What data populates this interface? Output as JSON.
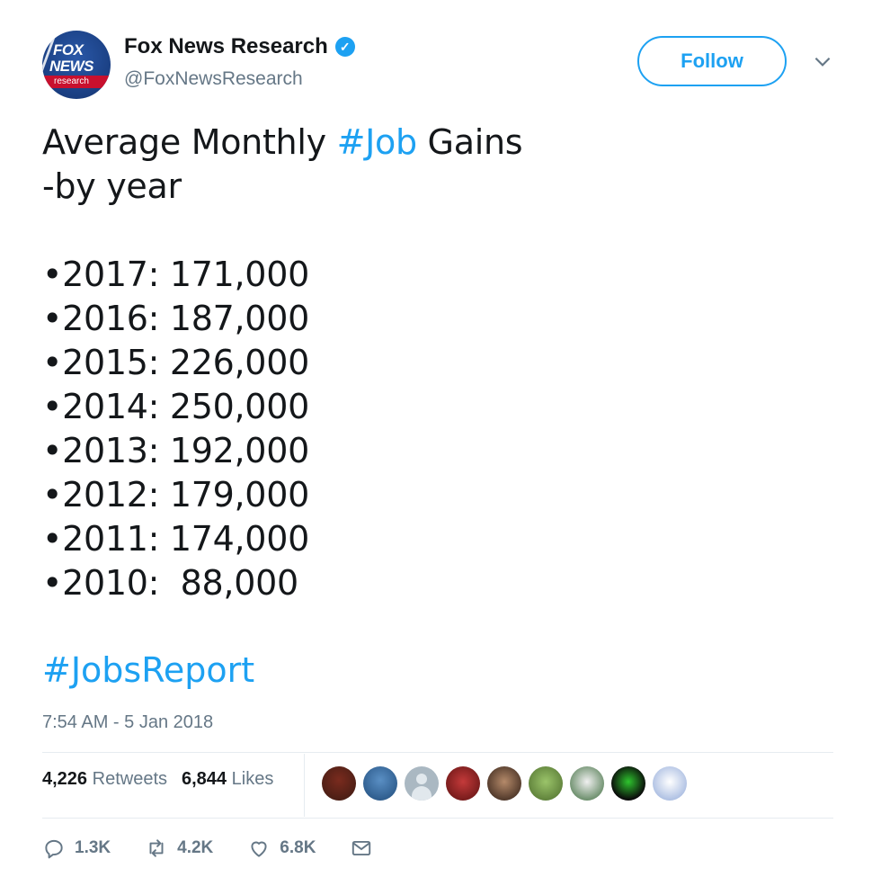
{
  "header": {
    "avatar_text": {
      "line1": "FOX",
      "line2": "NEWS",
      "line3": "research"
    },
    "name": "Fox News Research",
    "handle": "@FoxNewsResearch",
    "follow_label": "Follow"
  },
  "tweet": {
    "title_prefix": "Average Monthly ",
    "title_hashtag": "#Job",
    "title_suffix": " Gains",
    "subtitle": "-by year",
    "stats": [
      "•2017: 171,000",
      "•2016: 187,000",
      "•2015: 226,000",
      "•2014: 250,000",
      "•2013: 192,000",
      "•2012: 179,000",
      "•2011: 174,000",
      "•2010:  88,000"
    ],
    "hashtag_footer": "#JobsReport",
    "timestamp": "7:54 AM - 5 Jan 2018"
  },
  "engagement": {
    "retweets_count": "4,226",
    "retweets_label": "Retweets",
    "likes_count": "6,844",
    "likes_label": "Likes"
  },
  "actions": {
    "reply_count": "1.3K",
    "retweet_count": "4.2K",
    "like_count": "6.8K"
  },
  "colors": {
    "accent": "#1da1f2",
    "text": "#14171a",
    "muted": "#657786"
  }
}
